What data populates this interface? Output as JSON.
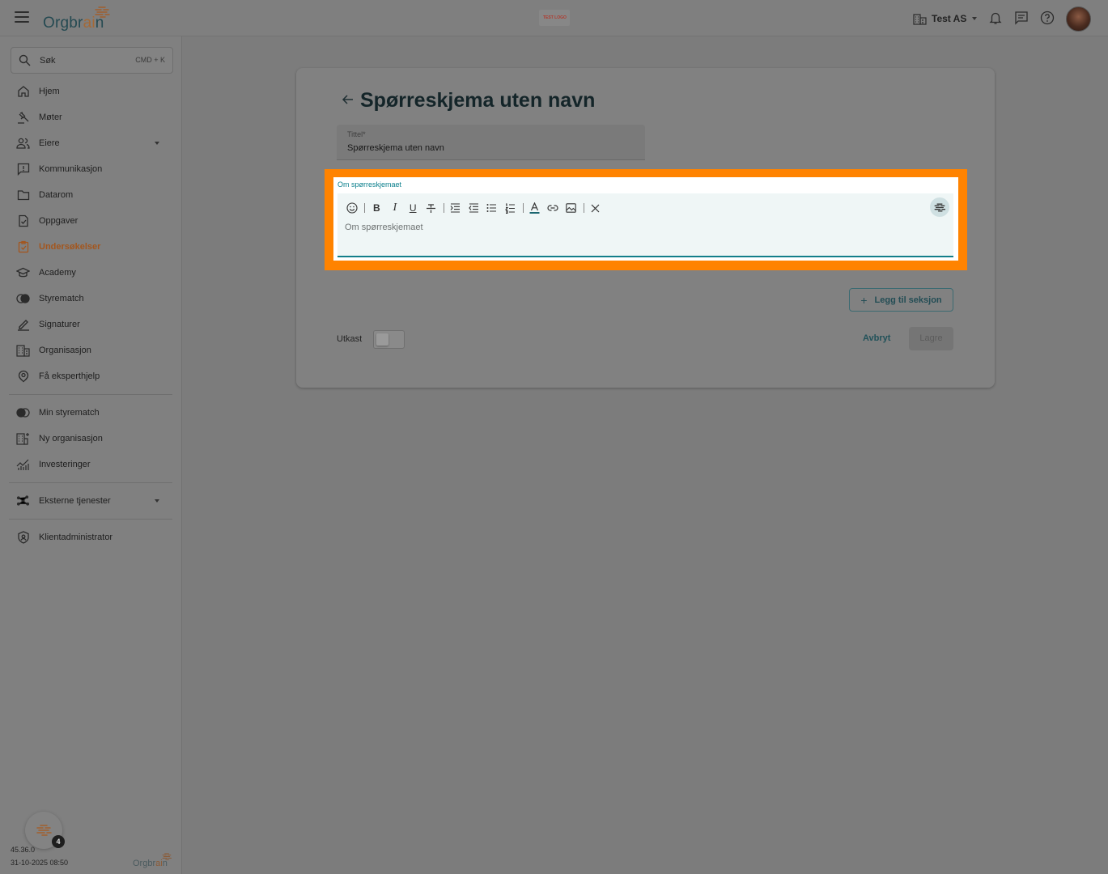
{
  "topbar": {
    "logo_prefix": "Orgbr",
    "logo_ai": "ai",
    "logo_suffix": "n",
    "test_logo": "TEST LOGO",
    "org_name": "Test AS"
  },
  "sidebar": {
    "search_placeholder": "Søk",
    "search_shortcut": "CMD + K",
    "items": [
      {
        "label": "Hjem",
        "icon": "home-icon"
      },
      {
        "label": "Møter",
        "icon": "gavel-icon"
      },
      {
        "label": "Eiere",
        "icon": "people-icon"
      },
      {
        "label": "Kommunikasjon",
        "icon": "chat-alert-icon"
      },
      {
        "label": "Datarom",
        "icon": "folder-icon"
      },
      {
        "label": "Oppgaver",
        "icon": "task-icon"
      },
      {
        "label": "Undersøkelser",
        "icon": "clipboard-icon"
      },
      {
        "label": "Academy",
        "icon": "graduation-cap-icon"
      },
      {
        "label": "Styrematch",
        "icon": "match-icon"
      },
      {
        "label": "Signaturer",
        "icon": "pen-icon"
      },
      {
        "label": "Organisasjon",
        "icon": "building-icon"
      },
      {
        "label": "Få eksperthjelp",
        "icon": "expert-icon"
      }
    ],
    "secondary": [
      {
        "label": "Min styrematch",
        "icon": "toggle-match-icon"
      },
      {
        "label": "Ny organisasjon",
        "icon": "building-add-icon"
      },
      {
        "label": "Investeringer",
        "icon": "chart-icon"
      }
    ],
    "external": {
      "label": "Eksterne tjenester",
      "icon": "hub-icon"
    },
    "admin": {
      "label": "Klientadministrator",
      "icon": "shield-icon"
    },
    "version": "45.36.0",
    "version_date": "31-10-2025 08:50",
    "badge_count": "4",
    "footer_logo_prefix": "Orgbr",
    "footer_logo_ai": "ai",
    "footer_logo_suffix": "n"
  },
  "main": {
    "title": "Spørreskjema uten navn",
    "title_field_label": "Tittel*",
    "title_field_value": "Spørreskjema uten navn",
    "editor_label": "Om spørreskjemaet",
    "editor_placeholder": "Om spørreskjemaet",
    "toolbar": {
      "bold": "B",
      "italic": "I",
      "underline": "U"
    },
    "add_section_label": "Legg til seksjon",
    "draft_label": "Utkast",
    "cancel_label": "Avbryt",
    "save_label": "Lagre"
  },
  "colors": {
    "accent": "#127e8a",
    "active_nav": "#a3561e",
    "highlight": "#ff8300"
  }
}
